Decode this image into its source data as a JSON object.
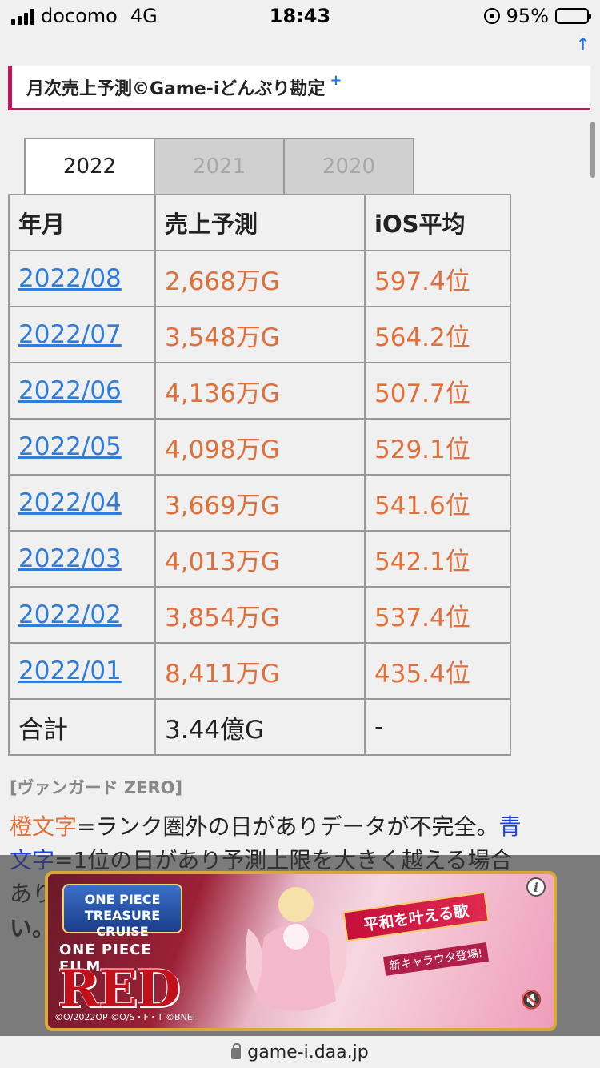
{
  "status_bar": {
    "carrier": "docomo",
    "network": "4G",
    "time": "18:43",
    "battery": "95%",
    "battery_level": 0.95
  },
  "up_link": "↑",
  "section": {
    "title": "月次売上予測©Game-iどんぶり勘定",
    "plus": "+"
  },
  "tabs": [
    {
      "label": "2022"
    },
    {
      "label": "2021"
    },
    {
      "label": "2020"
    }
  ],
  "table": {
    "headers": [
      "年月",
      "売上予測",
      "iOS平均"
    ],
    "rows": [
      {
        "month": "2022/08",
        "sales": "2,668万G",
        "ios": "597.4位"
      },
      {
        "month": "2022/07",
        "sales": "3,548万G",
        "ios": "564.2位"
      },
      {
        "month": "2022/06",
        "sales": "4,136万G",
        "ios": "507.7位"
      },
      {
        "month": "2022/05",
        "sales": "4,098万G",
        "ios": "529.1位"
      },
      {
        "month": "2022/04",
        "sales": "3,669万G",
        "ios": "541.6位"
      },
      {
        "month": "2022/03",
        "sales": "4,013万G",
        "ios": "542.1位"
      },
      {
        "month": "2022/02",
        "sales": "3,854万G",
        "ios": "537.4位"
      },
      {
        "month": "2022/01",
        "sales": "8,411万G",
        "ios": "435.4位"
      }
    ],
    "total": {
      "label": "合計",
      "sales": "3.44億G",
      "ios": "-"
    }
  },
  "game_label": "[ヴァンガード ZERO]",
  "legend": {
    "orange_word": "橙文字",
    "orange_text": "=ランク圏外の日がありデータが不完全。",
    "blue_word_1": "青",
    "blue_word_2": "文字",
    "blue_text": "=1位の日があり予測上限を大きく越える場合",
    "cut_line_1": "あり",
    "cut_line_2": "い。"
  },
  "ad": {
    "brand": "ONE PIECE TREASURE CRUISE",
    "film": "ONE PIECE FILM",
    "red": "RED",
    "banner": "平和を叶える歌",
    "sub": "新キャラウタ登場!",
    "copyright": "©O/2022OP ©O/S・F・T ©BNEI",
    "info": "i",
    "mute": "🔇"
  },
  "url": "game-i.daa.jp"
}
